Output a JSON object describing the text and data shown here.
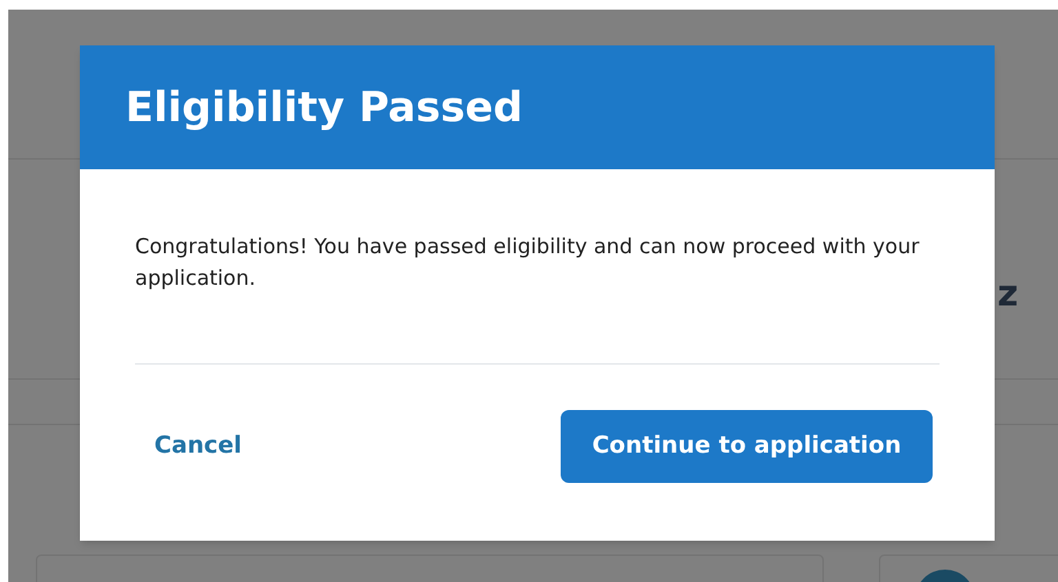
{
  "background": {
    "text": "z"
  },
  "dialog": {
    "title": "Eligibility Passed",
    "message": "Congratulations! You have passed eligibility and can now proceed with your application.",
    "buttons": [
      {
        "label": "Cancel",
        "kind": "link"
      },
      {
        "label": "Continue to application",
        "kind": "primary"
      }
    ]
  }
}
